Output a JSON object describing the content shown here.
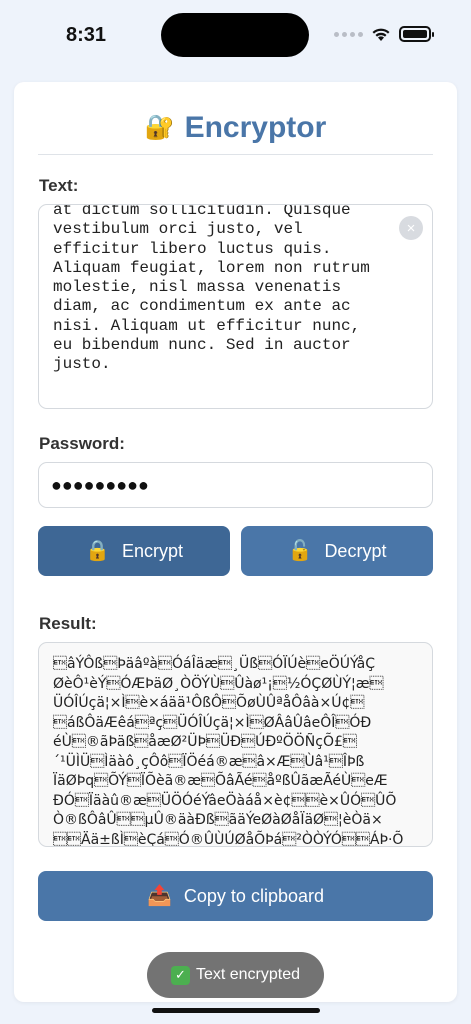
{
  "status_bar": {
    "time": "8:31"
  },
  "app": {
    "title_icon": "🔐",
    "title": "Encryptor"
  },
  "text_section": {
    "label": "Text:",
    "value": "at dictum sollicitudin. Quisque\nvestibulum orci justo, vel\nefficitur libero luctus quis.\nAliquam feugiat, lorem non rutrum\nmolestie, nisl massa venenatis\ndiam, ac condimentum ex ante ac\nnisi. Aliquam ut efficitur nunc,\neu bibendum nunc. Sed in auctor\njusto.",
    "clear_icon": "×"
  },
  "password_section": {
    "label": "Password:",
    "masked_value": "●●●●●●●●●"
  },
  "buttons": {
    "encrypt_icon": "🔒",
    "encrypt_label": "Encrypt",
    "decrypt_icon": "🔓",
    "decrypt_label": "Decrypt",
    "copy_icon": "📤",
    "copy_label": "Copy to clipboard"
  },
  "result_section": {
    "label": "Result:",
    "value": "\u0003âÝÔß\u0003Þäâºà\u0003ÓáÎäæ\u0003¸Üß\u0003ÓÏÚè\u0003eÖÚÝåÇ\nØèÔ¹èÝ\u0003ÓÆÞäØ¸ÒÖÝÙ\u0003Ûàø¹¡\u0003½ÓÇØÙÝ¦æ\u0003\nÜÓÎÚçä¦×Ì\u0003è×áää¹ÔßÔ\u0003ÕøÙÛªåÔâà×Ú¢\u0003\n\u0003áßÔäÆêá\u0003ªç\u0003ÜÓÎÚçä¦×Ì\u0003ØÂâÛâeÔÎ\u0003ÓÐ\néÙ\u0003®ãÞäß\u0003åæØ²ÜÞ\u0003ÜÐ\u0003ÚÐºÖÖÑçÕ£\u0003\n´¹ÜÌÜ\u0003Ìäàô¸çÔô\u0003ÏÖéá®æ\u0003â×Æ\u0003Ùâ¹\u0003ÎÞß\nÏäØÞq\u0003ÕÝ\u0003ÏÕèã®æ\u0003ÕâÃé\u0003åºßÛãæÃéÙ\u0003eÆ\nÐÓ\u0003Ïäàû®æ\u0003ÜÖÓéÝâeÖàáå×è¢\u0003\u0003è×ÛÓ\u0003ÛÕ\nÒ®ßÔâÛ\u0003\u0003µÛ®äàÐß\u0003ãäÝeØàØåÏäØ\u0003¦èÒä×\n\u0003\u0003Ää±ßÌ\u0003èÇá\u0003Ó®ÛÙÚØåÕÞá\u0003²ÒÒÝÓ\u0003\u0003ÁÞ·Õ"
  },
  "toast": {
    "icon": "✓",
    "message": "Text encrypted"
  }
}
